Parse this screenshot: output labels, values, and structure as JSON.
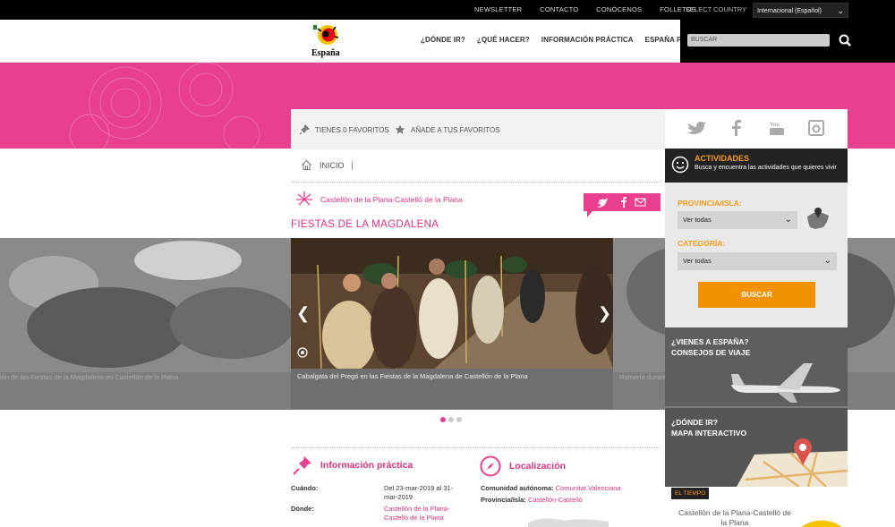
{
  "topbar": {
    "links": [
      "NEWSLETTER",
      "CONTACTO",
      "CONÓCENOS",
      "FOLLETOS"
    ],
    "select_country_label": "SELECT COUNTRY",
    "country_value": "Internacional (Español)"
  },
  "header": {
    "logo_text": "España",
    "nav": [
      "¿DÓNDE IR?",
      "¿QUÉ HACER?",
      "INFORMACIÓN PRÁCTICA",
      "ESPAÑA PARA..."
    ],
    "search_placeholder": "BUSCAR"
  },
  "favorites": {
    "count_label": "TIENES 0 FAVORITOS",
    "add_label": "AÑADE A TUS FAVORITOS"
  },
  "breadcrumb": {
    "home": "INICIO"
  },
  "location": {
    "text": "Castellón de la Plana-Castelló de la Plana"
  },
  "event": {
    "title": "FIESTAS DE LA MAGDALENA"
  },
  "gallery": {
    "caption": "Cabalgata del Pregó en las Fiestas de la Magdalena de Castellón de la Plana",
    "caption_left": "ión de las Fiestas de la Magdalena en Castellón de la Plana",
    "caption_right": "Romería durant",
    "slides": 3,
    "active_slide": 1
  },
  "info": {
    "title": "Información práctica",
    "cuando_label": "Cuándo:",
    "cuando_value_1": "Del 23-mar-2019 al 31-",
    "cuando_value_2": "mar-2019",
    "donde_label": "Dónde:",
    "donde_value_1": "Castellón de la Plana-",
    "donde_value_2": "Castelló de la Plana"
  },
  "localizacion": {
    "title": "Localización",
    "ca_label": "Comunidad autónoma:",
    "ca_value": "Comunitat Valenciana",
    "prov_label": "Provincia/Isla:",
    "prov_value": "Castellón-Castelló"
  },
  "actividades": {
    "title": "ACTIVIDADES",
    "subtitle": "Busca y encuentra las actividades que quieres vivir",
    "provincia_label": "PROVINCIA/ISLA:",
    "provincia_value": "Ver todas",
    "categoria_label": "CATEGORÍA:",
    "categoria_value": "Ver todas",
    "button": "BUSCAR"
  },
  "promos": {
    "viaje_1": "¿VIENES A ESPAÑA?",
    "viaje_2": "CONSEJOS DE VIAJE",
    "mapa_1": "¿DÓNDE IR?",
    "mapa_2": "MAPA INTERACTIVO"
  },
  "weather": {
    "tag": "EL TIEMPO",
    "city_1": "Castellón de la Plana-Castelló de",
    "city_2": "la Plana"
  },
  "colors": {
    "pink": "#e8408e",
    "orange": "#f39200",
    "dark": "#222222"
  }
}
